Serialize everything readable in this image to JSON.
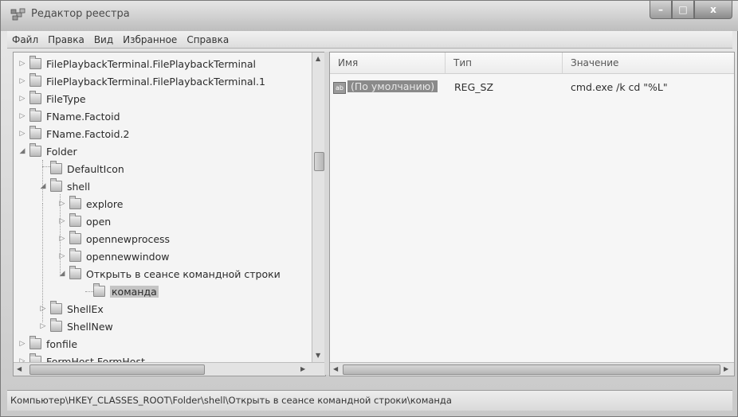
{
  "window": {
    "title": "Редактор реестра",
    "controls": {
      "minimize": "–",
      "maximize": "□",
      "close": "x"
    }
  },
  "menu": [
    "Файл",
    "Правка",
    "Вид",
    "Избранное",
    "Справка"
  ],
  "tree": {
    "items": [
      {
        "label": "FilePlaybackTerminal.FilePlaybackTerminal",
        "expander": "▷",
        "level": 0
      },
      {
        "label": "FilePlaybackTerminal.FilePlaybackTerminal.1",
        "expander": "▷",
        "level": 0
      },
      {
        "label": "FileType",
        "expander": "▷",
        "level": 0
      },
      {
        "label": "FName.Factoid",
        "expander": "▷",
        "level": 0
      },
      {
        "label": "FName.Factoid.2",
        "expander": "▷",
        "level": 0
      },
      {
        "label": "Folder",
        "expander": "◢",
        "level": 0
      },
      {
        "label": "DefaultIcon",
        "expander": "",
        "level": 1
      },
      {
        "label": "shell",
        "expander": "◢",
        "level": 1
      },
      {
        "label": "explore",
        "expander": "▷",
        "level": 2
      },
      {
        "label": "open",
        "expander": "▷",
        "level": 2
      },
      {
        "label": "opennewprocess",
        "expander": "▷",
        "level": 2
      },
      {
        "label": "opennewwindow",
        "expander": "▷",
        "level": 2
      },
      {
        "label": "Открыть в сеансе командной строки",
        "expander": "◢",
        "level": 2
      },
      {
        "label": "команда",
        "expander": "",
        "level": 3,
        "selected": true
      },
      {
        "label": "ShellEx",
        "expander": "▷",
        "level": 1
      },
      {
        "label": "ShellNew",
        "expander": "▷",
        "level": 1
      },
      {
        "label": "fonfile",
        "expander": "▷",
        "level": 0
      },
      {
        "label": "FormHost.FormHost",
        "expander": "▷",
        "level": 0
      }
    ]
  },
  "list": {
    "columns": [
      "Имя",
      "Тип",
      "Значение"
    ],
    "rows": [
      {
        "icon": "ab",
        "name": "(По умолчанию)",
        "type": "REG_SZ",
        "value": "cmd.exe /k cd \"%L\""
      }
    ]
  },
  "status": {
    "path": "Компьютер\\HKEY_CLASSES_ROOT\\Folder\\shell\\Открыть в сеансе командной строки\\команда"
  },
  "colors": {
    "selection": "#8a8a8a",
    "background": "#f4f4f4"
  }
}
